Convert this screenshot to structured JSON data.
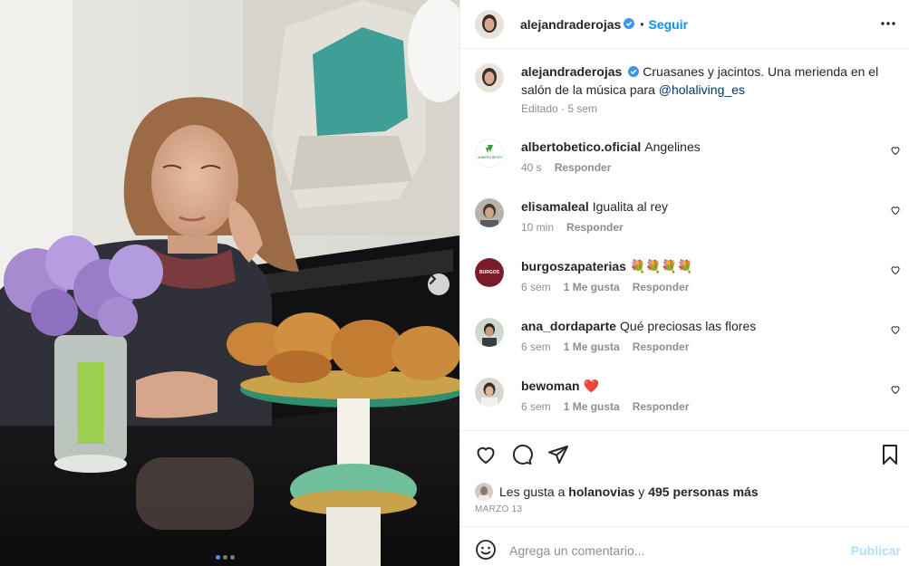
{
  "post": {
    "author": "alejandraderojas",
    "follow_label": "Seguir",
    "bullet": "•",
    "image_alt": "Mujer junto a un piano con jacintos y cruasanes",
    "carousel": {
      "count": 3,
      "active": 1
    }
  },
  "caption": {
    "username": "alejandraderojas",
    "text": "Cruasanes y jacintos. Una merienda en el salón de la música para ",
    "mention": "@holaliving_es",
    "meta": "Editado · 5 sem"
  },
  "comments": [
    {
      "username": "albertobetico.oficial",
      "text": "Angelines",
      "time": "40 s",
      "likes": "",
      "reply": "Responder",
      "avatar_label": "ALBERTO BETICO"
    },
    {
      "username": "elisamaleal",
      "text": "Igualita al rey",
      "time": "10 min",
      "likes": "",
      "reply": "Responder"
    },
    {
      "username": "burgoszapaterias",
      "text": "💐💐💐💐",
      "time": "6 sem",
      "likes": "1 Me gusta",
      "reply": "Responder",
      "avatar_label": "BURGOS"
    },
    {
      "username": "ana_dordaparte",
      "text": "Qué preciosas las flores",
      "time": "6 sem",
      "likes": "1 Me gusta",
      "reply": "Responder"
    },
    {
      "username": "bewoman",
      "text": "❤️",
      "time": "6 sem",
      "likes": "1 Me gusta",
      "reply": "Responder"
    }
  ],
  "likes": {
    "prefix": "Les gusta a ",
    "user": "holanovias",
    "connector": " y ",
    "others": "495 personas más"
  },
  "date": "MARZO 13",
  "composer": {
    "placeholder": "Agrega un comentario...",
    "publish_label": "Publicar"
  },
  "icons": [
    "more-icon",
    "verified-icon",
    "heart-icon",
    "comment-icon",
    "share-icon",
    "bookmark-icon",
    "emoji-icon",
    "chevron-right-icon"
  ],
  "colors": {
    "link": "#0095f6",
    "mention": "#00376b",
    "verified": "#3897f0",
    "publish_disabled": "#b2dffc",
    "burgos_brand": "#7a1b2a"
  }
}
